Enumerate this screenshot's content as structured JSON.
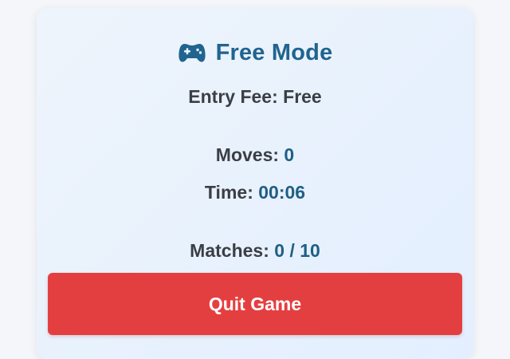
{
  "header": {
    "icon": "gamepad-icon",
    "title": "Free Mode"
  },
  "entry_fee": {
    "label": "Entry Fee:",
    "value": "Free"
  },
  "stats": {
    "moves_label": "Moves:",
    "moves_value": "0",
    "time_label": "Time:",
    "time_value": "00:06",
    "matches_label": "Matches:",
    "matches_value": "0 / 10"
  },
  "actions": {
    "quit_label": "Quit Game"
  },
  "colors": {
    "accent": "#20648f",
    "danger": "#e43f40"
  }
}
